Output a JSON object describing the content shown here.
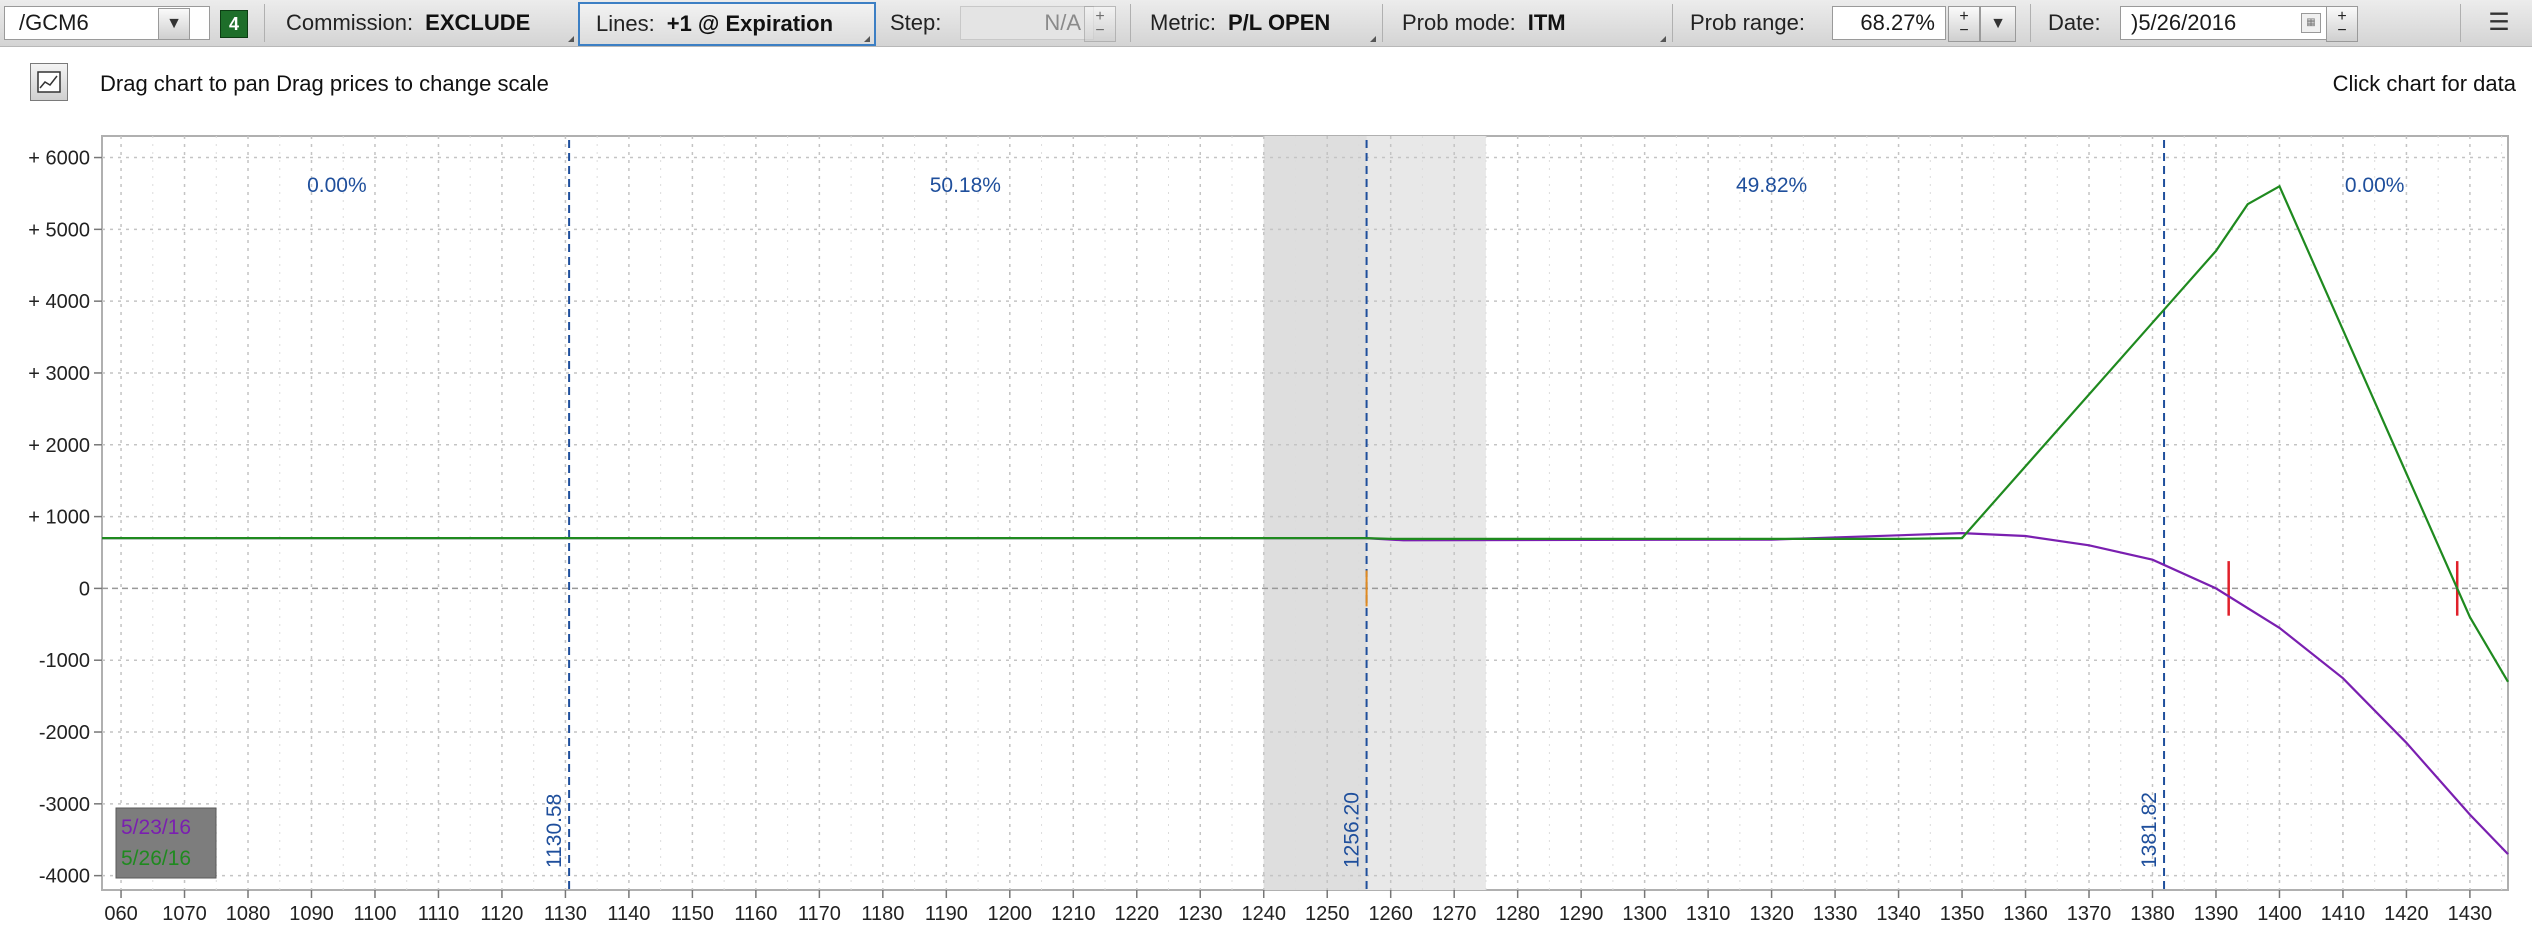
{
  "toolbar": {
    "symbol": "/GCM6",
    "badge": "4",
    "commission_label": "Commission:",
    "commission_value": "EXCLUDE",
    "lines_label": "Lines:",
    "lines_value": "+1 @ Expiration",
    "step_label": "Step:",
    "step_value": "N/A",
    "metric_label": "Metric:",
    "metric_value": "P/L OPEN",
    "probmode_label": "Prob mode:",
    "probmode_value": "ITM",
    "probrange_label": "Prob range:",
    "probrange_value": "68.27%",
    "date_label": "Date:",
    "date_value": ")5/26/2016"
  },
  "info": {
    "drag_hint": "Drag chart to pan Drag prices to change scale",
    "click_hint": "Click chart for data"
  },
  "colors": {
    "green_line": "#1f8a1f",
    "purple_line": "#7a1fb0",
    "marker_blue": "#1f4f9c",
    "breakeven_red": "#e0202a",
    "shaded_band": "#e8e8e8"
  },
  "chart_data": {
    "type": "line",
    "xlabel": "",
    "ylabel": "",
    "xlim": [
      1057,
      1436
    ],
    "ylim": [
      -4200,
      6300
    ],
    "grid": true,
    "x_tick_labels": [
      "060",
      "1070",
      "1080",
      "1090",
      "1100",
      "1110",
      "1120",
      "1130",
      "1140",
      "1150",
      "1160",
      "1170",
      "1180",
      "1190",
      "1200",
      "1210",
      "1220",
      "1230",
      "1240",
      "1250",
      "1260",
      "1270",
      "1280",
      "1290",
      "1300",
      "1310",
      "1320",
      "1330",
      "1340",
      "1350",
      "1360",
      "1370",
      "1380",
      "1390",
      "1400",
      "1410",
      "1420",
      "1430"
    ],
    "x_ticks": [
      1060,
      1070,
      1080,
      1090,
      1100,
      1110,
      1120,
      1130,
      1140,
      1150,
      1160,
      1170,
      1180,
      1190,
      1200,
      1210,
      1220,
      1230,
      1240,
      1250,
      1260,
      1270,
      1280,
      1290,
      1300,
      1310,
      1320,
      1330,
      1340,
      1350,
      1360,
      1370,
      1380,
      1390,
      1400,
      1410,
      1420,
      1430
    ],
    "y_tick_labels": [
      "+ 6000",
      "+ 5000",
      "+ 4000",
      "+ 3000",
      "+ 2000",
      "+ 1000",
      "0",
      "-1000",
      "-2000",
      "-3000",
      "-4000"
    ],
    "y_ticks": [
      6000,
      5000,
      4000,
      3000,
      2000,
      1000,
      0,
      -1000,
      -2000,
      -3000,
      -4000
    ],
    "shaded_range": [
      1240,
      1275
    ],
    "vertical_markers": [
      {
        "x": 1130.58,
        "label": "1130.58"
      },
      {
        "x": 1256.2,
        "label": "1256.20"
      },
      {
        "x": 1381.82,
        "label": "1381.82"
      }
    ],
    "zone_probabilities": [
      {
        "x_center": 1094,
        "label": "0.00%"
      },
      {
        "x_center": 1193,
        "label": "50.18%"
      },
      {
        "x_center": 1320,
        "label": "49.82%"
      },
      {
        "x_center": 1415,
        "label": "0.00%"
      }
    ],
    "breakeven_marks": [
      1392,
      1428
    ],
    "series": [
      {
        "name": "5/26/16",
        "x": [
          1057,
          1256,
          1260,
          1340,
          1350,
          1380,
          1390,
          1395,
          1400,
          1420,
          1430,
          1436
        ],
        "y": [
          700,
          700,
          690,
          690,
          700,
          3700,
          4700,
          5350,
          5600,
          1600,
          -400,
          -1300
        ]
      },
      {
        "name": "5/23/16",
        "x": [
          1057,
          1256,
          1262,
          1320,
          1340,
          1350,
          1360,
          1370,
          1380,
          1390,
          1400,
          1410,
          1420,
          1430,
          1436
        ],
        "y": [
          700,
          700,
          670,
          680,
          740,
          770,
          730,
          600,
          400,
          0,
          -550,
          -1250,
          -2150,
          -3150,
          -3700
        ]
      }
    ],
    "legend": [
      "5/23/16",
      "5/26/16"
    ],
    "legend_position": "bottom-left"
  }
}
